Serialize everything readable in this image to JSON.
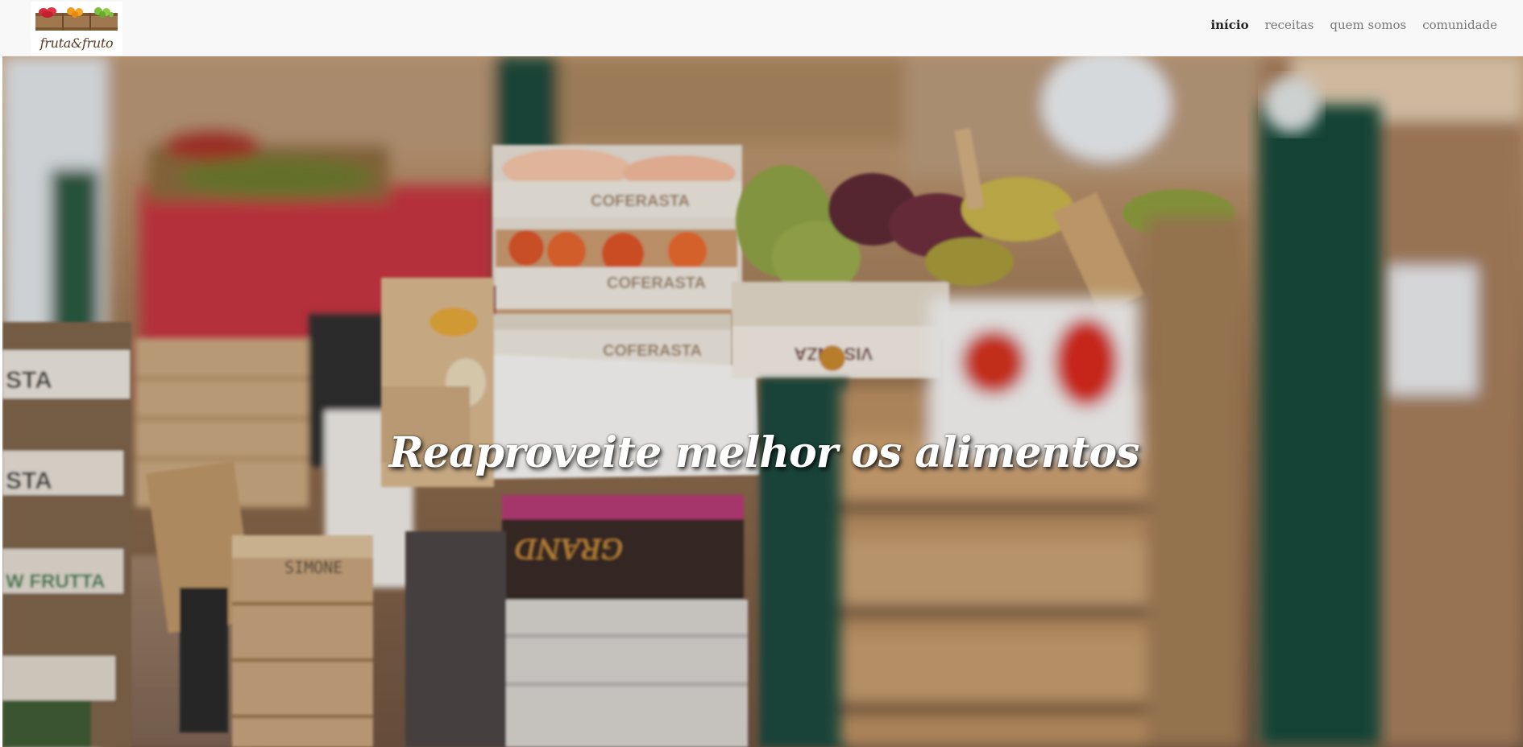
{
  "brand": {
    "name": "fruta&fruto",
    "logo_icon": "produce-crates-logo"
  },
  "nav": {
    "items": [
      {
        "label": "início",
        "active": true
      },
      {
        "label": "receitas",
        "active": false
      },
      {
        "label": "quem somos",
        "active": false
      },
      {
        "label": "comunidade",
        "active": false
      }
    ]
  },
  "hero": {
    "headline": "Reaproveite melhor os alimentos",
    "image": "market-stall-produce-crates-photo",
    "crate_labels": [
      "COFERASTA",
      "COFERASTA",
      "COFERASTA",
      "VISONZA",
      "STA",
      "STA",
      "W FRUTTA",
      "SIMONE",
      "GRAND"
    ]
  },
  "colors": {
    "navbar_bg": "#f8f8f8",
    "nav_active": "#222222",
    "nav_inactive": "#777777",
    "headline": "#ffffff"
  }
}
